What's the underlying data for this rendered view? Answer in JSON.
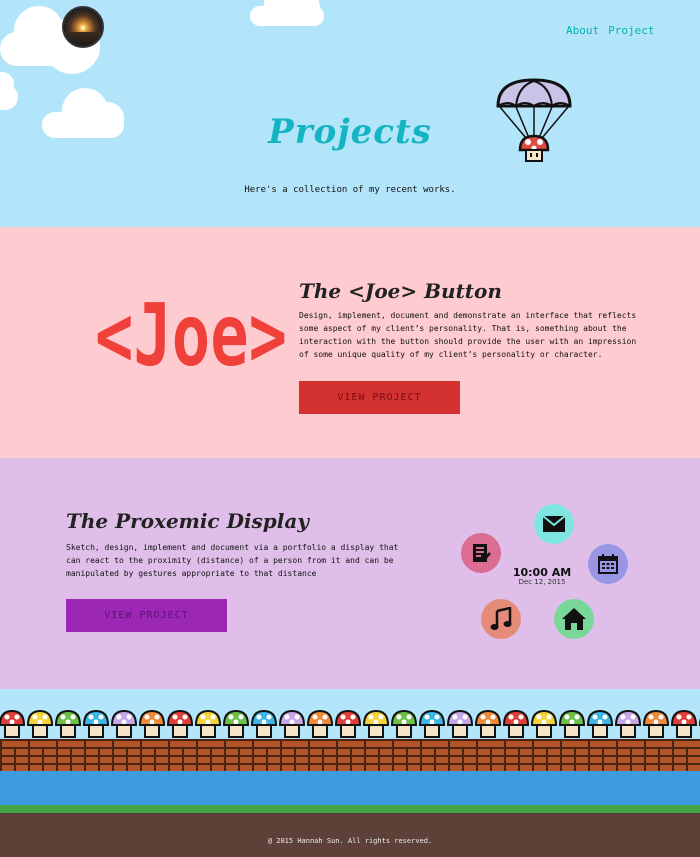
{
  "nav": {
    "items": [
      {
        "label": "About"
      },
      {
        "label": "Project"
      }
    ]
  },
  "hero": {
    "title": "Projects",
    "subtitle": "Here's a collection of my recent works."
  },
  "projects": [
    {
      "logo_text": "<Joe>",
      "title": "The <Joe> Button",
      "description": "Design, implement, document and demonstrate an interface that reflects some aspect of my client’s personality. That is, something about the interaction with the button should provide the user with an impression of some unique quality of my client’s personality or character.",
      "button_label": "VIEW PROJECT",
      "accent": "#d43131"
    },
    {
      "title": "The Proxemic Display",
      "description": "Sketch, design, implement and document via a portfolio a display that can react to the proximity (distance) of a person from it and can be manipulated by gestures appropriate to that distance",
      "button_label": "VIEW PROJECT",
      "accent": "#9c27b5",
      "clock": {
        "time": "10:00 AM",
        "date": "Dec 12, 2015"
      },
      "icons": [
        "mail-icon",
        "checklist-icon",
        "calendar-icon",
        "music-icon",
        "home-icon"
      ]
    }
  ],
  "footer": {
    "copyright": "@ 2015 Hannah Sun. All rights reserved."
  },
  "colors": {
    "sky": "#b3e5fa",
    "joe_bg": "#fecbd1",
    "proxemic_bg": "#dfbfe9",
    "title_teal": "#14b4c2",
    "joe_red": "#f0403a"
  }
}
